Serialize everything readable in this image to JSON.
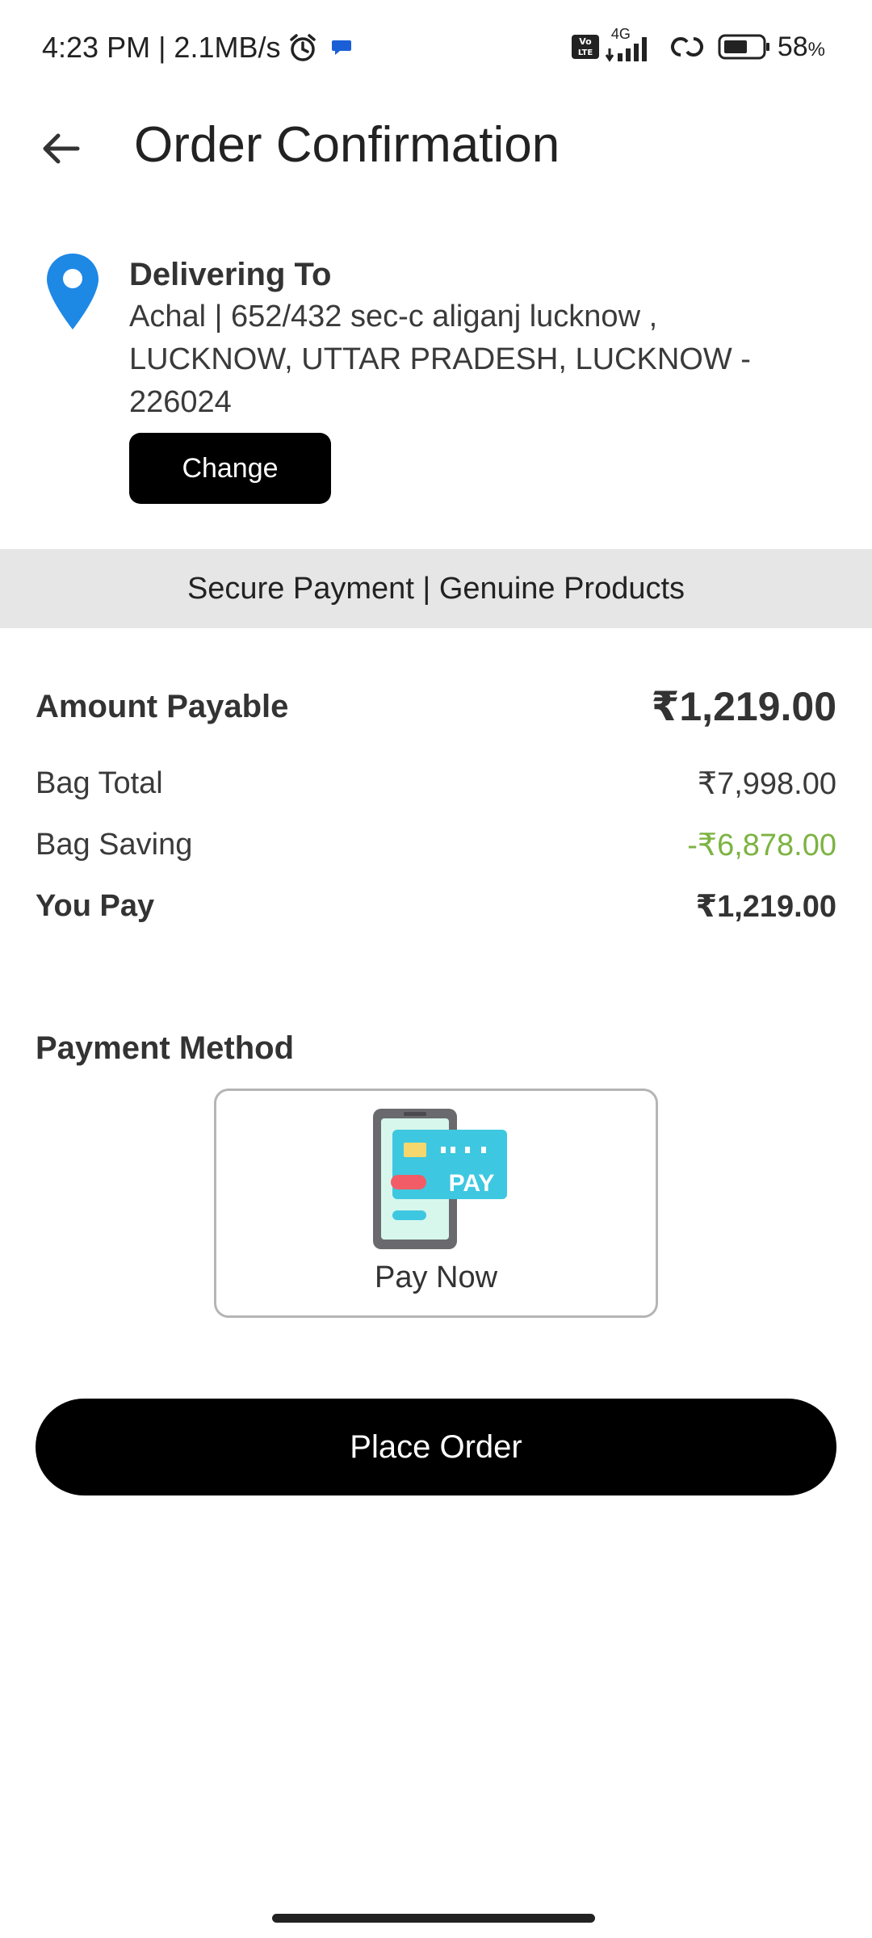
{
  "status_bar": {
    "time_speed": "4:23 PM | 2.1MB/s",
    "network": "4G",
    "volte": "Vo LTE",
    "battery": "58",
    "battery_unit": "%"
  },
  "app_bar": {
    "title": "Order Confirmation"
  },
  "address": {
    "title": "Delivering To",
    "text": "Achal | 652/432 sec-c aliganj lucknow , LUCKNOW, UTTAR PRADESH, LUCKNOW - 226024",
    "change_label": "Change"
  },
  "banner": {
    "text": "Secure Payment | Genuine Products"
  },
  "summary": {
    "amount_payable_label": "Amount Payable",
    "amount_payable_value": "₹1,219.00",
    "bag_total_label": "Bag Total",
    "bag_total_value": "₹7,998.00",
    "bag_saving_label": "Bag Saving",
    "bag_saving_value": "-₹6,878.00",
    "you_pay_label": "You Pay",
    "you_pay_value": "₹1,219.00"
  },
  "payment": {
    "title": "Payment Method",
    "option_label": "Pay Now",
    "card_badge": "PAY"
  },
  "actions": {
    "place_order_label": "Place Order"
  },
  "colors": {
    "saving": "#7cb342",
    "pin": "#1e88e5",
    "button": "#000000",
    "banner_bg": "#e6e6e6"
  }
}
